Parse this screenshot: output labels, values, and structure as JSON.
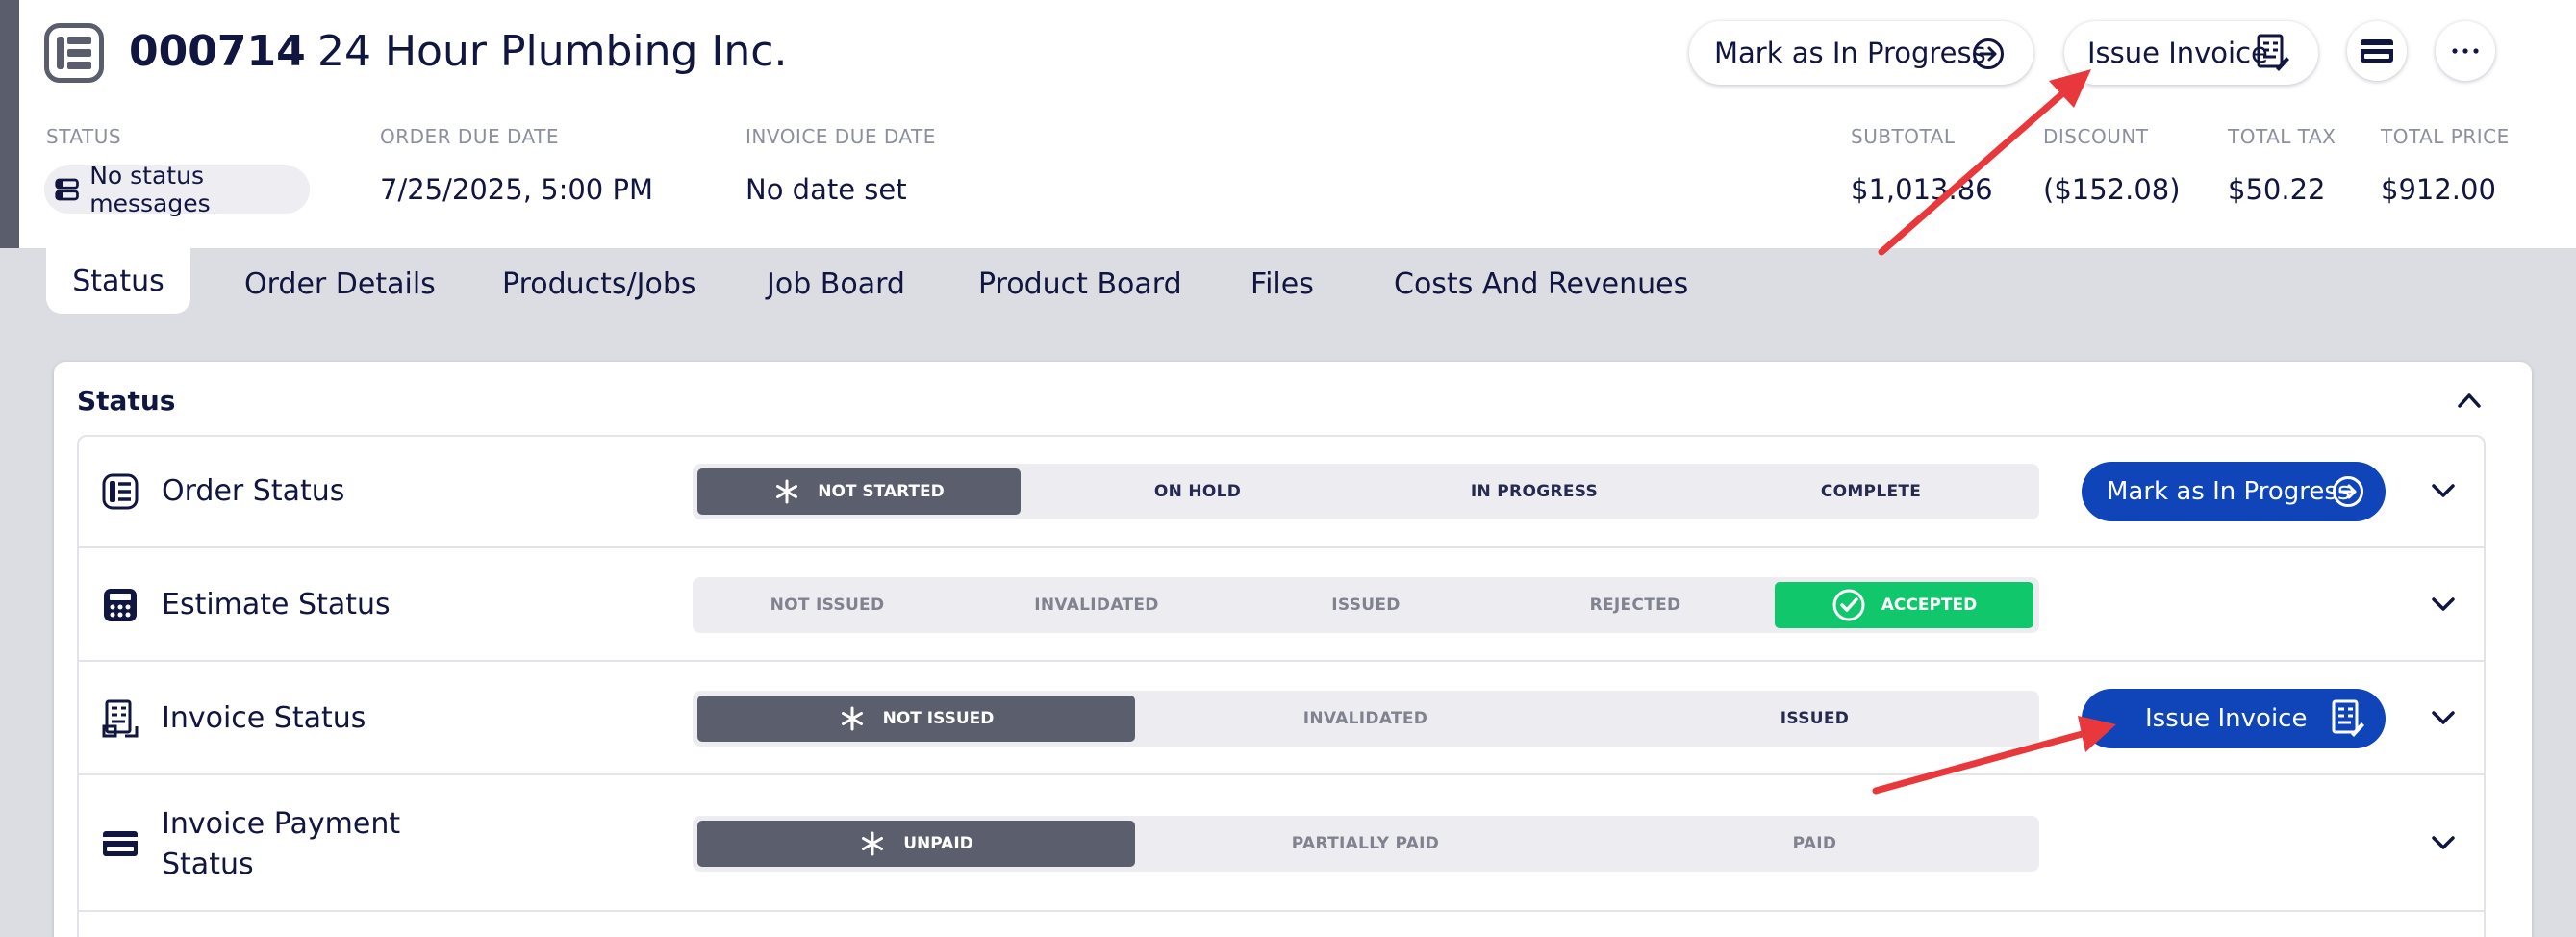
{
  "header": {
    "order_number": "000714",
    "company": "24 Hour Plumbing Inc.",
    "mark_in_progress_label": "Mark as In Progress",
    "issue_invoice_label": "Issue Invoice",
    "icons": {
      "order": "order-list-icon",
      "arrow": "arrow-right-circle-icon",
      "invoice": "invoice-icon",
      "card": "credit-card-icon",
      "more": "more-horizontal-icon"
    }
  },
  "meta": {
    "status_label": "STATUS",
    "status_value": "No status messages",
    "order_due_label": "ORDER DUE DATE",
    "order_due_value": "7/25/2025, 5:00 PM",
    "invoice_due_label": "INVOICE DUE DATE",
    "invoice_due_value": "No date set",
    "subtotal_label": "SUBTOTAL",
    "subtotal_value": "$1,013.86",
    "discount_label": "DISCOUNT",
    "discount_value": "($152.08)",
    "tax_label": "TOTAL TAX",
    "tax_value": "$50.22",
    "total_label": "TOTAL PRICE",
    "total_value": "$912.00"
  },
  "tabs": [
    "Status",
    "Order Details",
    "Products/Jobs",
    "Job Board",
    "Product Board",
    "Files",
    "Costs And Revenues"
  ],
  "active_tab": "Status",
  "panel": {
    "title": "Status",
    "rows": [
      {
        "label": "Order Status",
        "stages": [
          "NOT STARTED",
          "ON HOLD",
          "IN PROGRESS",
          "COMPLETE"
        ],
        "current": "NOT STARTED",
        "action": "Mark as In Progress"
      },
      {
        "label": "Estimate Status",
        "stages": [
          "NOT ISSUED",
          "INVALIDATED",
          "ISSUED",
          "REJECTED",
          "ACCEPTED"
        ],
        "current": "ACCEPTED"
      },
      {
        "label": "Invoice Status",
        "stages": [
          "NOT ISSUED",
          "INVALIDATED",
          "ISSUED"
        ],
        "current": "NOT ISSUED",
        "action": "Issue Invoice"
      },
      {
        "label_line1": "Invoice Payment",
        "label_line2": "Status",
        "stages": [
          "UNPAID",
          "PARTIALLY PAID",
          "PAID"
        ],
        "current": "UNPAID"
      }
    ]
  },
  "colors": {
    "navy": "#111640",
    "action_blue": "#0f45b8",
    "active_stage": "#5b5e6c",
    "accepted_green": "#11c76b",
    "annotation_red": "#e8383b",
    "page_bg": "#dcdde2"
  }
}
